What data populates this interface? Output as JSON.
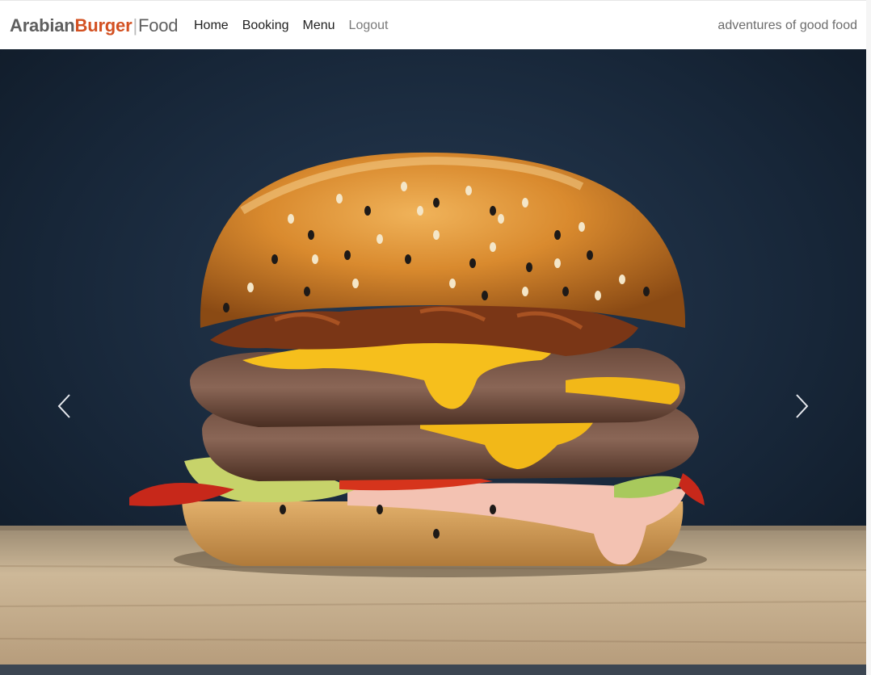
{
  "brand": {
    "part1": "Arabian",
    "part2": "Burger",
    "separator": "|",
    "part3": "Food",
    "colors": {
      "primary": "#5f5f5f",
      "accent": "#d35122"
    }
  },
  "nav": {
    "items": [
      {
        "label": "Home"
      },
      {
        "label": "Booking"
      },
      {
        "label": "Menu"
      },
      {
        "label": "Logout"
      }
    ]
  },
  "tagline": "adventures of good food",
  "carousel": {
    "image": "double-cheeseburger-photo",
    "prev_icon": "chevron-left-icon",
    "next_icon": "chevron-right-icon"
  }
}
